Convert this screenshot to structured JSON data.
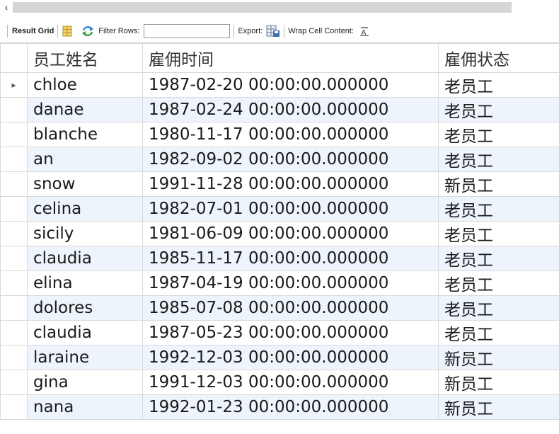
{
  "scrollbar": {
    "left_arrow": "‹"
  },
  "toolbar": {
    "result_grid": "Result Grid",
    "filter_rows": "Filter Rows:",
    "filter_value": "",
    "export": "Export:",
    "wrap_cell": "Wrap Cell Content:"
  },
  "grid": {
    "columns": [
      "员工姓名",
      "雇佣时间",
      "雇佣状态"
    ],
    "current_row_marker": "▸",
    "rows": [
      {
        "name": "chloe",
        "hired": "1987-02-20 00:00:00.000000",
        "status": "老员工"
      },
      {
        "name": "danae",
        "hired": "1987-02-24 00:00:00.000000",
        "status": "老员工"
      },
      {
        "name": "blanche",
        "hired": "1980-11-17 00:00:00.000000",
        "status": "老员工"
      },
      {
        "name": "an",
        "hired": "1982-09-02 00:00:00.000000",
        "status": "老员工"
      },
      {
        "name": "snow",
        "hired": "1991-11-28 00:00:00.000000",
        "status": "新员工"
      },
      {
        "name": "celina",
        "hired": "1982-07-01 00:00:00.000000",
        "status": "老员工"
      },
      {
        "name": "sicily",
        "hired": "1981-06-09 00:00:00.000000",
        "status": "老员工"
      },
      {
        "name": "claudia",
        "hired": "1985-11-17 00:00:00.000000",
        "status": "老员工"
      },
      {
        "name": "elina",
        "hired": "1987-04-19 00:00:00.000000",
        "status": "老员工"
      },
      {
        "name": "dolores",
        "hired": "1985-07-08 00:00:00.000000",
        "status": "老员工"
      },
      {
        "name": "claudia",
        "hired": "1987-05-23 00:00:00.000000",
        "status": "老员工"
      },
      {
        "name": "laraine",
        "hired": "1992-12-03 00:00:00.000000",
        "status": "新员工"
      },
      {
        "name": "gina",
        "hired": "1991-12-03 00:00:00.000000",
        "status": "新员工"
      },
      {
        "name": "nana",
        "hired": "1992-01-23 00:00:00.000000",
        "status": "新员工"
      }
    ]
  }
}
